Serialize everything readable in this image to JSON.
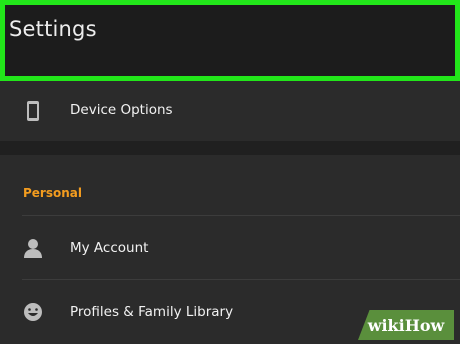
{
  "header": {
    "title": "Settings"
  },
  "device_section": {
    "item": {
      "label": "Device Options",
      "icon": "phone-icon"
    }
  },
  "personal_section": {
    "heading": "Personal",
    "items": [
      {
        "label": "My Account",
        "icon": "person-icon"
      },
      {
        "label": "Profiles & Family Library",
        "icon": "smiley-icon"
      }
    ]
  },
  "watermark": {
    "text": "wikiHow"
  },
  "colors": {
    "highlight": "#22e61a",
    "accent": "#f39c1f",
    "background": "#262626"
  }
}
